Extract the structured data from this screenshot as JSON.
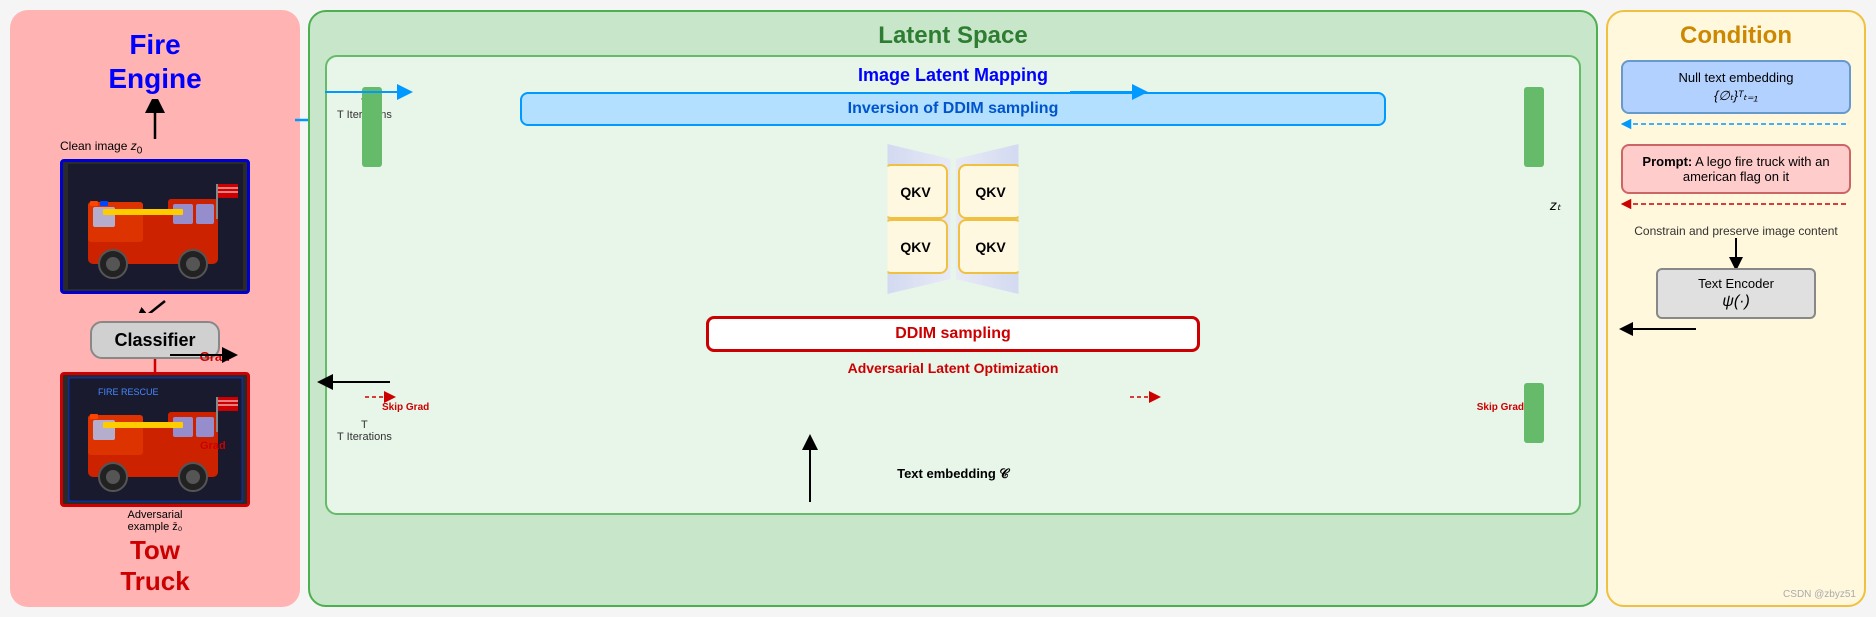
{
  "left": {
    "title_line1": "Fire",
    "title_line2": "Engine",
    "clean_image_label": "Clean image z₀",
    "classifier_label": "Classifier",
    "adv_label_line1": "Adversarial",
    "adv_label_line2": "example z̄₀",
    "tow_truck_line1": "Tow",
    "tow_truck_line2": "Truck",
    "grad_label": "Grad",
    "grad_label2": "Grad"
  },
  "middle": {
    "title": "Latent Space",
    "ilm_title": "Image Latent Mapping",
    "ddim_inversion": "Inversion of DDIM sampling",
    "qkv1": "QKV",
    "qkv2": "QKV",
    "qkv3": "QKV",
    "qkv4": "QKV",
    "ddim_sampling": "DDIM sampling",
    "adv_latent": "Adversarial Latent Optimization",
    "t_iterations1": "T Iterations",
    "t_iterations2": "T Iterations",
    "skip_grad1": "Skip Grad",
    "skip_grad2": "Skip Grad",
    "text_embedding": "Text embedding 𝒞",
    "zt": "zₜ"
  },
  "right": {
    "title": "Condition",
    "null_text": "Null text embedding",
    "null_text_math": "{∅ₜ}ᵀₜ₌₁",
    "prompt_label": "Prompt:",
    "prompt_text": "A lego fire truck with an american flag on it",
    "constrain_text": "Constrain and preserve image content",
    "text_encoder": "Text Encoder",
    "psi": "ψ(·)"
  }
}
